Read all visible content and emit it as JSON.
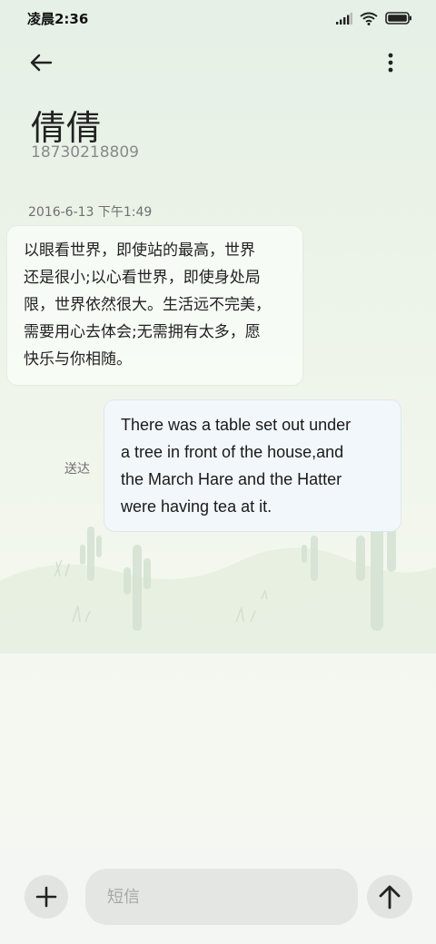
{
  "status_bar": {
    "time": "凌晨2:36",
    "icons": [
      "signal-icon",
      "wifi-icon",
      "battery-icon"
    ]
  },
  "top_bar": {
    "back_icon": "back-arrow-icon",
    "more_icon": "more-vertical-icon"
  },
  "contact": {
    "name": "倩倩",
    "number": "18730218809"
  },
  "conversation": {
    "timestamp": "2016-6-13 下午1:49",
    "messages": [
      {
        "direction": "incoming",
        "lines": [
          "以眼看世界，即使站的最高，世界",
          "还是很小;以心看世界，即使身处局",
          "限，世界依然很大。生活远不完美，",
          "需要用心去体会;无需拥有太多，愿",
          "快乐与你相随。"
        ]
      },
      {
        "direction": "outgoing",
        "lines": [
          "There was a table set out under",
          "a tree in front of the house,and",
          "the March Hare and the Hatter",
          "were having tea at it."
        ],
        "status": "送达"
      }
    ]
  },
  "composer": {
    "attach_icon": "plus-icon",
    "placeholder": "短信",
    "value": "",
    "send_icon": "send-arrow-up-icon"
  },
  "colors": {
    "background_top": "#e6f0e6",
    "background_bottom": "#f6f8f3",
    "incoming_bubble": "#f7fcf6",
    "outgoing_bubble": "#f2f7fb",
    "button_bg": "#e2e4e2"
  }
}
